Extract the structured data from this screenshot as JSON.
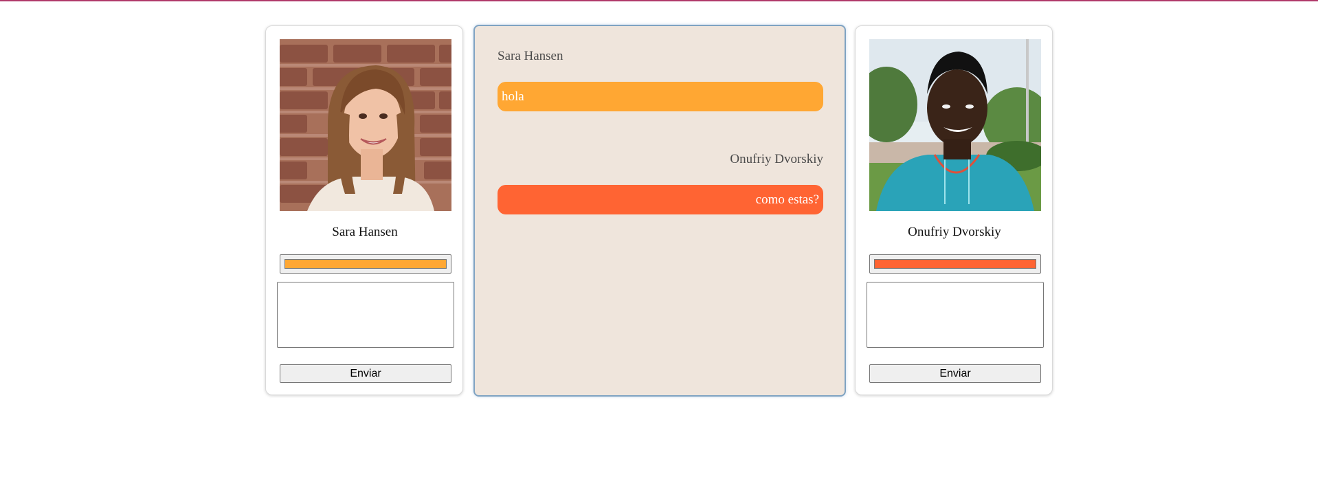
{
  "colors": {
    "top_line": "#b03a6a",
    "chat_background": "#efe5dc",
    "user1_color": "#ffa733",
    "user2_color": "#ff6433"
  },
  "users": [
    {
      "name": "Sara Hansen",
      "photo": "woman-portrait-brick-wall",
      "message_draft": "",
      "send_label": "Enviar"
    },
    {
      "name": "Onufriy Dvorskiy",
      "photo": "man-portrait-outdoors",
      "message_draft": "",
      "send_label": "Enviar"
    }
  ],
  "chat": {
    "messages": [
      {
        "sender": "Sara Hansen",
        "text": "hola",
        "align": "left"
      },
      {
        "sender": "Onufriy Dvorskiy",
        "text": "como estas?",
        "align": "right"
      }
    ]
  }
}
